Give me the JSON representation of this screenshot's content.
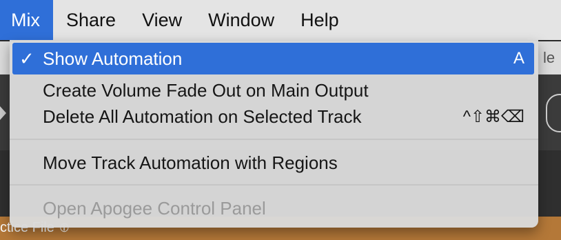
{
  "menubar": {
    "items": [
      {
        "label": "Mix",
        "active": true
      },
      {
        "label": "Share"
      },
      {
        "label": "View"
      },
      {
        "label": "Window"
      },
      {
        "label": "Help"
      }
    ]
  },
  "background": {
    "edge_text": "le",
    "footer_text": "ctice File"
  },
  "menu": {
    "items": [
      {
        "label": "Show Automation",
        "checked": true,
        "check_glyph": "✓",
        "shortcut": "A",
        "highlighted": true
      },
      {
        "label": "Create Volume Fade Out on Main Output"
      },
      {
        "label": "Delete All Automation on Selected Track",
        "shortcut": "^⇧⌘⌫"
      },
      {
        "label": "Move Track Automation with Regions"
      },
      {
        "label": "Open Apogee Control Panel",
        "disabled": true
      }
    ]
  },
  "colors": {
    "accent": "#2f6fd8",
    "menu_bg": "#dadada",
    "disabled_text": "#9a9a9a"
  }
}
